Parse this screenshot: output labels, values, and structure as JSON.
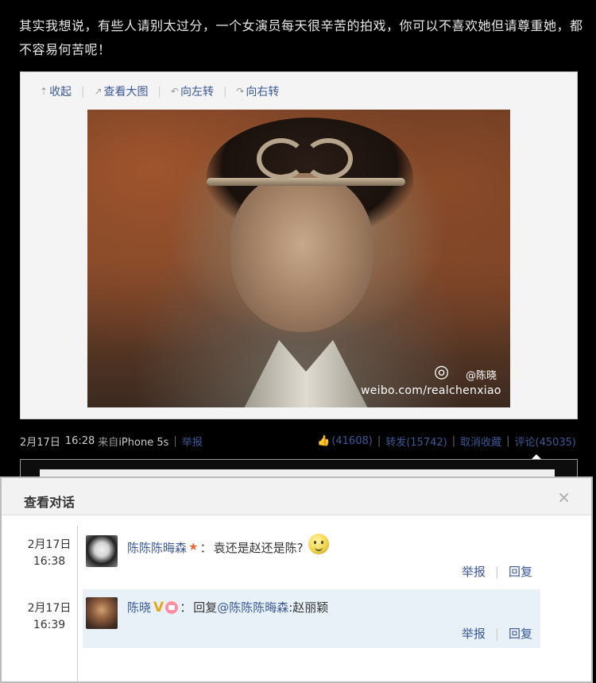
{
  "post": {
    "text": "其实我想说，有些人请别太过分，一个女演员每天很辛苦的拍戏，你可以不喜欢她但请尊重她，都不容易何苦呢！"
  },
  "media_toolbar": {
    "collapse": "收起",
    "view_large": "查看大图",
    "rotate_left": "向左转",
    "rotate_right": "向右转"
  },
  "photo": {
    "watermark_name": "@陈晓",
    "watermark_url": "weibo.com/realchenxiao"
  },
  "meta": {
    "date": "2月17日",
    "time": "16:28",
    "source_prefix": "来自",
    "source": "iPhone 5s",
    "report": "举报",
    "likes": "(41608)",
    "repost": "转发(15742)",
    "unfavorite": "取消收藏",
    "comment": "评论(45035)"
  },
  "dialog": {
    "title": "查看对话",
    "close": "×",
    "entries": [
      {
        "date": "2月17日",
        "time": "16:38",
        "user": "陈陈陈晦森",
        "colon": "：",
        "text": "袁还是赵还是陈?",
        "report": "举报",
        "reply": "回复"
      },
      {
        "date": "2月17日",
        "time": "16:39",
        "user": "陈晓",
        "badge_v": "V",
        "colon": "：",
        "reply_prefix": "回复",
        "mention": "@陈陈陈晦森",
        "text": ":赵丽颖",
        "report": "举报",
        "reply": "回复"
      }
    ]
  }
}
